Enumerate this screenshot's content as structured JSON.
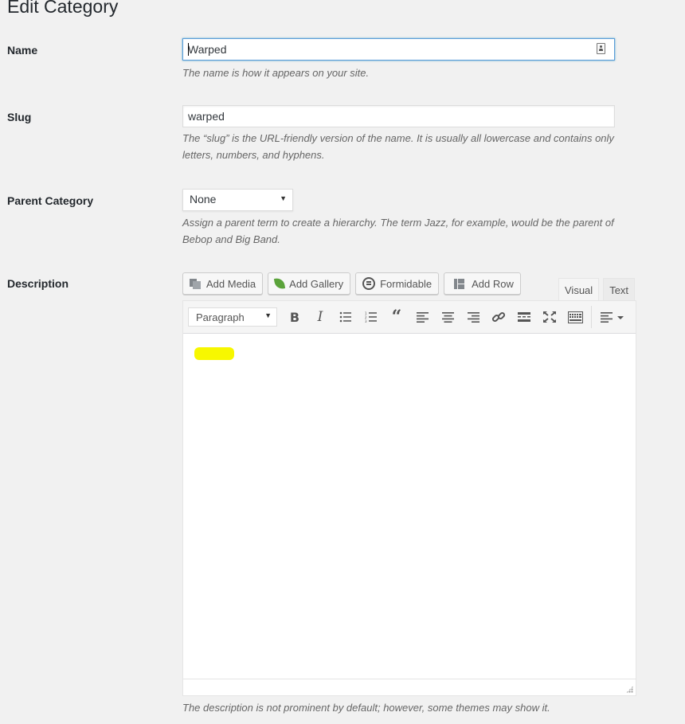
{
  "page": {
    "title": "Edit Category"
  },
  "name_field": {
    "label": "Name",
    "value": "Warped",
    "help": "The name is how it appears on your site."
  },
  "slug_field": {
    "label": "Slug",
    "value": "warped",
    "help_line1": "The “slug” is the URL-friendly version of the name. It is usually all lowercase and contains only",
    "help_line2": "letters, numbers, and hyphens."
  },
  "parent_field": {
    "label": "Parent Category",
    "selected": "None",
    "help_line1": "Assign a parent term to create a hierarchy. The term Jazz, for example, would be the parent of",
    "help_line2": "Bebop and Big Band."
  },
  "description_field": {
    "label": "Description",
    "help": "The description is not prominent by default; however, some themes may show it.",
    "media_buttons": [
      {
        "label": "Add Media",
        "icon": "add-media-icon"
      },
      {
        "label": "Add Gallery",
        "icon": "leaf-icon"
      },
      {
        "label": "Formidable",
        "icon": "formidable-icon"
      },
      {
        "label": "Add Row",
        "icon": "add-row-icon"
      }
    ],
    "tabs": {
      "visual": "Visual",
      "text": "Text",
      "active": "Visual"
    },
    "toolbar": {
      "format_select": "Paragraph",
      "buttons": [
        "bold-icon",
        "italic-icon",
        "bulleted-list-icon",
        "numbered-list-icon",
        "blockquote-icon",
        "align-left-icon",
        "align-center-icon",
        "align-right-icon",
        "insert-link-icon",
        "read-more-icon",
        "fullscreen-icon",
        "toolbar-toggle-icon",
        "text-align-dropdown-icon"
      ]
    },
    "highlight_color": "#f7f700"
  },
  "colors": {
    "background": "#f1f1f1",
    "focus_border": "#5b9dd9",
    "help_text": "#666666"
  }
}
